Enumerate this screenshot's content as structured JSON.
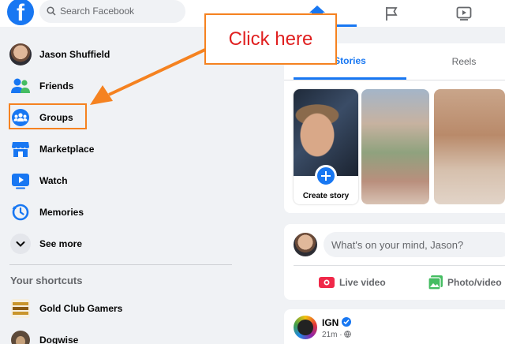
{
  "topbar": {
    "logo_letter": "f",
    "search_placeholder": "Search Facebook",
    "nav": [
      "home-icon",
      "pages-flag-icon",
      "watch-icon"
    ],
    "accent_color": "#1877f2"
  },
  "sidebar": {
    "items": [
      {
        "label": "Jason Shuffield",
        "icon": "profile-avatar"
      },
      {
        "label": "Friends",
        "icon": "friends-icon"
      },
      {
        "label": "Groups",
        "icon": "groups-icon"
      },
      {
        "label": "Marketplace",
        "icon": "marketplace-icon"
      },
      {
        "label": "Watch",
        "icon": "watch-icon"
      },
      {
        "label": "Memories",
        "icon": "memories-clock-icon"
      },
      {
        "label": "See more",
        "icon": "chevron-down-icon"
      }
    ],
    "shortcuts_title": "Your shortcuts",
    "shortcuts": [
      {
        "label": "Gold Club Gamers",
        "icon": "gold-club-gamers-logo"
      },
      {
        "label": "Dogwise",
        "icon": "dogwise-logo"
      }
    ]
  },
  "annotation": {
    "callout_text": "Click here",
    "highlight_color": "#f58220",
    "text_color": "#e02020"
  },
  "stories": {
    "tabs": [
      "Stories",
      "Reels"
    ],
    "active_tab": "Stories",
    "create_label": "Create story"
  },
  "composer": {
    "placeholder": "What's on your mind, Jason?",
    "live_label": "Live video",
    "photo_label": "Photo/video"
  },
  "post": {
    "author": "IGN",
    "meta": "21m · ",
    "privacy_icon": "globe-icon"
  }
}
